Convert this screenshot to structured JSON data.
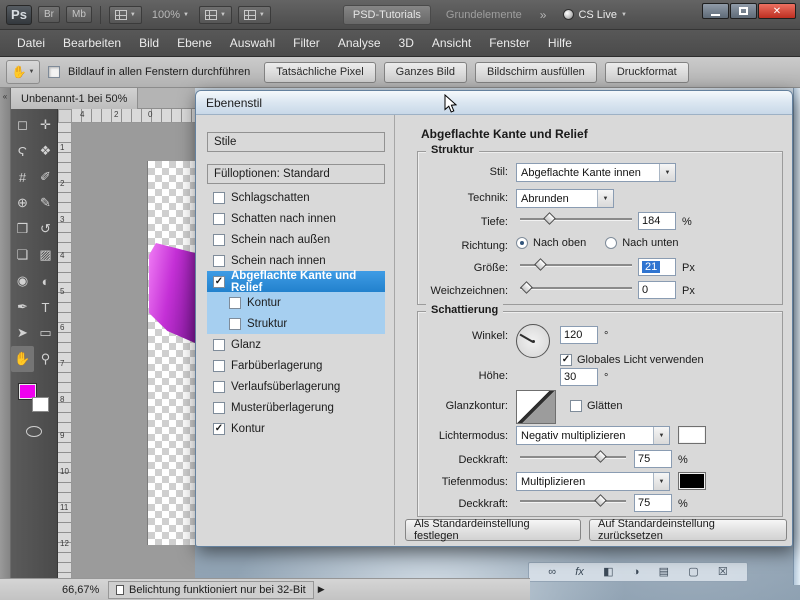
{
  "icons": {
    "chevron_down": "▼",
    "play": "▶",
    "check": "✓",
    "collapse": "«",
    "close": "✕",
    "hand_tool": "✋"
  },
  "titlebar": {
    "logo": "Ps",
    "bridge": "Br",
    "minibridge": "Mb",
    "zoom": "100%",
    "workspace_active": "PSD-Tutorials",
    "workspace_other": "Grundelemente",
    "overflow": "»",
    "cslive": "CS Live"
  },
  "menubar": {
    "items": [
      "Datei",
      "Bearbeiten",
      "Bild",
      "Ebene",
      "Auswahl",
      "Filter",
      "Analyse",
      "3D",
      "Ansicht",
      "Fenster",
      "Hilfe"
    ]
  },
  "optionsbar": {
    "scroll_all": "Bildlauf in allen Fenstern durchführen",
    "buttons": [
      "Tatsächliche Pixel",
      "Ganzes Bild",
      "Bildschirm ausfüllen",
      "Druckformat"
    ]
  },
  "document_tab": "Unbenannt-1 bei 50%",
  "ruler": {
    "horizontal": [
      "4",
      "2",
      "0"
    ],
    "vertical": [
      "1",
      "2",
      "3",
      "4",
      "5",
      "6",
      "7",
      "8",
      "9",
      "10",
      "11",
      "12"
    ]
  },
  "tools": [
    {
      "name": "rectangular-marquee",
      "glyph": "◻"
    },
    {
      "name": "move",
      "glyph": "✛"
    },
    {
      "name": "lasso",
      "glyph": "Ϛ"
    },
    {
      "name": "quick-selection",
      "glyph": "❖"
    },
    {
      "name": "crop",
      "glyph": "#"
    },
    {
      "name": "eyedropper",
      "glyph": "✐"
    },
    {
      "name": "spot-healing",
      "glyph": "⊕"
    },
    {
      "name": "brush",
      "glyph": "✎"
    },
    {
      "name": "clone-stamp",
      "glyph": "❒"
    },
    {
      "name": "history-brush",
      "glyph": "↺"
    },
    {
      "name": "eraser",
      "glyph": "❏"
    },
    {
      "name": "gradient",
      "glyph": "▨"
    },
    {
      "name": "blur",
      "glyph": "◉"
    },
    {
      "name": "dodge",
      "glyph": "◐"
    },
    {
      "name": "pen",
      "glyph": "✒"
    },
    {
      "name": "type",
      "glyph": "T"
    },
    {
      "name": "path-selection",
      "glyph": "➤"
    },
    {
      "name": "shape",
      "glyph": "▭"
    },
    {
      "name": "hand",
      "glyph": "✋"
    },
    {
      "name": "zoom",
      "glyph": "⚲"
    }
  ],
  "dialog": {
    "title": "Ebenenstil",
    "left": {
      "styles_header": "Stile",
      "fill_options": "Fülloptionen: Standard",
      "items": [
        {
          "label": "Schlagschatten",
          "checked": false
        },
        {
          "label": "Schatten nach innen",
          "checked": false
        },
        {
          "label": "Schein nach außen",
          "checked": false
        },
        {
          "label": "Schein nach innen",
          "checked": false
        },
        {
          "label": "Abgeflachte Kante und Relief",
          "checked": true,
          "selected": true
        },
        {
          "label": "Kontur",
          "checked": false,
          "sub": true
        },
        {
          "label": "Struktur",
          "checked": false,
          "sub": true
        },
        {
          "label": "Glanz",
          "checked": false
        },
        {
          "label": "Farbüberlagerung",
          "checked": false
        },
        {
          "label": "Verlaufsüberlagerung",
          "checked": false
        },
        {
          "label": "Musterüberlagerung",
          "checked": false
        },
        {
          "label": "Kontur",
          "checked": true
        }
      ]
    },
    "panel": {
      "heading": "Abgeflachte Kante und Relief",
      "struktur": {
        "title": "Struktur",
        "stil_label": "Stil:",
        "stil_value": "Abgeflachte Kante innen",
        "technik_label": "Technik:",
        "technik_value": "Abrunden",
        "tiefe_label": "Tiefe:",
        "tiefe_value": "184",
        "tiefe_unit": "%",
        "richtung_label": "Richtung:",
        "richtung_oben": "Nach oben",
        "richtung_oben_selected": true,
        "richtung_unten": "Nach unten",
        "groesse_label": "Größe:",
        "groesse_value": "21",
        "groesse_unit": "Px",
        "weich_label": "Weichzeichnen:",
        "weich_value": "0",
        "weich_unit": "Px"
      },
      "schattierung": {
        "title": "Schattierung",
        "winkel_label": "Winkel:",
        "winkel_value": "120",
        "winkel_unit": "°",
        "global_light_label": "Globales Licht verwenden",
        "global_light_checked": true,
        "hoehe_label": "Höhe:",
        "hoehe_value": "30",
        "hoehe_unit": "°",
        "glanzkontur_label": "Glanzkontur:",
        "glaetten_label": "Glätten",
        "glaetten_checked": false,
        "lichtermodus_label": "Lichtermodus:",
        "lichtermodus_value": "Negativ multiplizieren",
        "lichtermodus_color": "#ffffff",
        "deckkraft1_label": "Deckkraft:",
        "deckkraft1_value": "75",
        "deckkraft1_unit": "%",
        "tiefenmodus_label": "Tiefenmodus:",
        "tiefenmodus_value": "Multiplizieren",
        "tiefenmodus_color": "#000000",
        "deckkraft2_label": "Deckkraft:",
        "deckkraft2_value": "75",
        "deckkraft2_unit": "%"
      },
      "footer": {
        "set_default": "Als Standardeinstellung festlegen",
        "reset_default": "Auf Standardeinstellung zurücksetzen"
      }
    }
  },
  "statusbar": {
    "zoom": "66,67%",
    "message": "Belichtung funktioniert nur bei 32-Bit"
  },
  "dock": {
    "icons": [
      {
        "name": "link-layers",
        "glyph": "∞"
      },
      {
        "name": "layer-effects",
        "glyph": "fx"
      },
      {
        "name": "layer-mask",
        "glyph": "◧"
      },
      {
        "name": "adjustment-layer",
        "glyph": "◑"
      },
      {
        "name": "layer-group",
        "glyph": "▤"
      },
      {
        "name": "new-layer",
        "glyph": "▢"
      },
      {
        "name": "delete-layer",
        "glyph": "☒"
      }
    ]
  },
  "colors": {
    "foreground_swatch": "#f000f0",
    "selection_blue": "#2f93e0"
  }
}
